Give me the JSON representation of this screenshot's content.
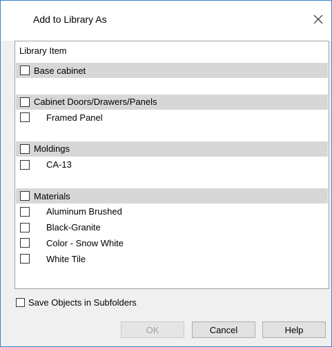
{
  "dialog": {
    "title": "Add to Library As",
    "close_icon": "close-icon"
  },
  "list": {
    "header": "Library Item",
    "rows": [
      {
        "type": "category",
        "label": "Base cabinet",
        "checked": false
      },
      {
        "type": "blank"
      },
      {
        "type": "category",
        "label": "Cabinet Doors/Drawers/Panels",
        "checked": false
      },
      {
        "type": "child",
        "label": "Framed Panel",
        "checked": false
      },
      {
        "type": "blank"
      },
      {
        "type": "category",
        "label": "Moldings",
        "checked": false
      },
      {
        "type": "child",
        "label": "CA-13",
        "checked": false
      },
      {
        "type": "blank"
      },
      {
        "type": "category",
        "label": "Materials",
        "checked": false
      },
      {
        "type": "child",
        "label": "Aluminum Brushed",
        "checked": false
      },
      {
        "type": "child",
        "label": "Black-Granite",
        "checked": false
      },
      {
        "type": "child",
        "label": "Color - Snow White",
        "checked": false
      },
      {
        "type": "child",
        "label": "White Tile",
        "checked": false
      }
    ]
  },
  "options": {
    "save_subfolders_label": "Save Objects in Subfolders",
    "save_subfolders_checked": false
  },
  "buttons": {
    "ok": "OK",
    "cancel": "Cancel",
    "help": "Help"
  },
  "colors": {
    "category_bg": "#d7d7d7",
    "border_accent": "#3c82c8"
  }
}
